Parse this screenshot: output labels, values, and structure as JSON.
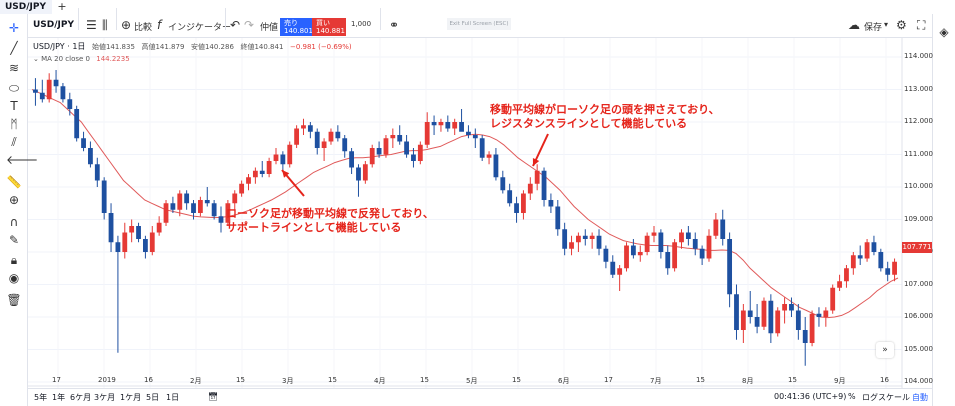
{
  "tabs": [
    {
      "label": "USD/JPY"
    }
  ],
  "toolbar": {
    "symbol": "USD/JPY",
    "compare_label": "比較",
    "indicators_label": "インジケーター",
    "order_label": "仲値",
    "sell_label": "売り",
    "sell_price": "140.801",
    "buy_label": "買い",
    "buy_price": "140.881",
    "quantity": "1,000",
    "exit_fullscreen": "Exit Full Screen (ESC)",
    "save_label": "保存"
  },
  "legend": {
    "symbol": "USD/JPY · 1日",
    "open": "始値141.835",
    "high": "高値141.879",
    "low": "安値140.286",
    "close": "終値140.841",
    "change": "−0.981 (−0.69%)",
    "ma_label": "MA 20 close 0",
    "ma_value": "144.2235"
  },
  "annotations": {
    "resistance_line1": "移動平均線がローソク足の頭を押さえており、",
    "resistance_line2": "レジスタンスラインとして機能している",
    "support_line1": "ローソク足が移動平均線で反発しており、",
    "support_line2": "サポートラインとして機能している"
  },
  "price_axis": {
    "labels": [
      "114.000",
      "113.000",
      "112.000",
      "111.000",
      "110.000",
      "109.000",
      "108.000",
      "107.000",
      "106.000",
      "105.000",
      "104.000"
    ],
    "last_price": "107.771"
  },
  "time_axis": {
    "labels": [
      "17",
      "2019",
      "16",
      "2月",
      "15",
      "3月",
      "15",
      "4月",
      "15",
      "5月",
      "15",
      "6月",
      "17",
      "7月",
      "15",
      "8月",
      "15",
      "9月",
      "16"
    ]
  },
  "bottom_bar": {
    "ranges": [
      "5年",
      "1年",
      "6ケ月",
      "3ケ月",
      "1ケ月",
      "5日",
      "1日"
    ],
    "time": "00:41:36 (UTC+9)",
    "percent": "%",
    "log": "ログスケール",
    "auto": "自動"
  },
  "chart_data": {
    "type": "candlestick",
    "series": "USD/JPY daily",
    "ylim": [
      104.0,
      114.4
    ],
    "colors": {
      "up": "#e53935",
      "down": "#1e50a0",
      "ma": "#e05a5a"
    },
    "candles": [
      [
        113.0,
        113.35,
        112.5,
        112.9
      ],
      [
        112.9,
        113.3,
        112.6,
        112.7
      ],
      [
        112.7,
        113.5,
        112.6,
        113.3
      ],
      [
        113.3,
        113.6,
        112.9,
        113.1
      ],
      [
        113.1,
        113.2,
        112.6,
        112.7
      ],
      [
        112.7,
        112.9,
        112.2,
        112.4
      ],
      [
        112.4,
        112.5,
        111.4,
        111.5
      ],
      [
        111.5,
        111.7,
        111.1,
        111.2
      ],
      [
        111.2,
        111.4,
        110.6,
        110.7
      ],
      [
        110.7,
        110.9,
        110.0,
        110.2
      ],
      [
        110.2,
        110.3,
        109.0,
        109.2
      ],
      [
        109.2,
        109.5,
        108.0,
        108.3
      ],
      [
        108.3,
        108.5,
        104.9,
        108.0
      ],
      [
        108.0,
        108.9,
        107.8,
        108.6
      ],
      [
        108.6,
        109.0,
        108.3,
        108.8
      ],
      [
        108.8,
        108.9,
        108.3,
        108.4
      ],
      [
        108.4,
        108.5,
        107.8,
        108.0
      ],
      [
        108.0,
        108.8,
        107.9,
        108.6
      ],
      [
        108.6,
        109.1,
        108.5,
        108.9
      ],
      [
        108.9,
        109.6,
        108.8,
        109.5
      ],
      [
        109.5,
        109.7,
        109.2,
        109.3
      ],
      [
        109.3,
        109.9,
        109.1,
        109.8
      ],
      [
        109.8,
        109.9,
        109.3,
        109.5
      ],
      [
        109.5,
        109.6,
        109.0,
        109.2
      ],
      [
        109.2,
        109.7,
        109.1,
        109.6
      ],
      [
        109.6,
        110.0,
        109.4,
        109.5
      ],
      [
        109.5,
        109.6,
        109.0,
        109.1
      ],
      [
        109.1,
        109.4,
        108.6,
        108.9
      ],
      [
        108.9,
        109.6,
        108.8,
        109.5
      ],
      [
        109.5,
        109.9,
        109.3,
        109.8
      ],
      [
        109.8,
        110.2,
        109.7,
        110.1
      ],
      [
        110.1,
        110.4,
        109.9,
        110.3
      ],
      [
        110.3,
        110.6,
        110.1,
        110.5
      ],
      [
        110.5,
        110.8,
        110.3,
        110.4
      ],
      [
        110.4,
        110.9,
        110.3,
        110.8
      ],
      [
        110.8,
        111.2,
        110.7,
        111.0
      ],
      [
        111.0,
        111.1,
        110.5,
        110.7
      ],
      [
        110.7,
        111.4,
        110.6,
        111.3
      ],
      [
        111.3,
        111.9,
        111.2,
        111.8
      ],
      [
        111.8,
        112.1,
        111.6,
        111.9
      ],
      [
        111.9,
        112.0,
        111.5,
        111.7
      ],
      [
        111.7,
        111.8,
        111.0,
        111.2
      ],
      [
        111.2,
        111.5,
        110.8,
        111.4
      ],
      [
        111.4,
        111.8,
        111.3,
        111.7
      ],
      [
        111.7,
        111.9,
        111.4,
        111.5
      ],
      [
        111.5,
        111.6,
        110.9,
        111.1
      ],
      [
        111.1,
        111.2,
        110.4,
        110.6
      ],
      [
        110.6,
        110.7,
        109.7,
        110.2
      ],
      [
        110.2,
        110.8,
        110.1,
        110.7
      ],
      [
        110.7,
        111.3,
        110.6,
        111.2
      ],
      [
        111.2,
        111.4,
        110.9,
        111.0
      ],
      [
        111.0,
        111.6,
        110.9,
        111.5
      ],
      [
        111.5,
        111.8,
        111.2,
        111.6
      ],
      [
        111.6,
        111.9,
        111.3,
        111.4
      ],
      [
        111.4,
        111.6,
        110.9,
        111.0
      ],
      [
        111.0,
        111.2,
        110.6,
        110.8
      ],
      [
        110.8,
        111.4,
        110.7,
        111.3
      ],
      [
        111.3,
        112.3,
        111.2,
        112.0
      ],
      [
        112.0,
        112.2,
        111.6,
        111.9
      ],
      [
        111.9,
        112.1,
        111.7,
        112.0
      ],
      [
        112.0,
        112.2,
        111.7,
        111.8
      ],
      [
        111.8,
        112.1,
        111.6,
        112.0
      ],
      [
        112.0,
        112.4,
        111.8,
        111.7
      ],
      [
        111.7,
        111.9,
        111.5,
        111.6
      ],
      [
        111.6,
        111.8,
        111.2,
        111.5
      ],
      [
        111.5,
        111.6,
        110.8,
        110.9
      ],
      [
        110.9,
        111.1,
        110.7,
        111.0
      ],
      [
        111.0,
        111.2,
        110.2,
        110.3
      ],
      [
        110.3,
        110.5,
        109.8,
        109.9
      ],
      [
        109.9,
        110.1,
        109.4,
        109.5
      ],
      [
        109.5,
        109.7,
        108.9,
        109.2
      ],
      [
        109.2,
        109.9,
        109.0,
        109.8
      ],
      [
        109.8,
        110.3,
        109.6,
        110.1
      ],
      [
        110.1,
        110.7,
        109.9,
        110.5
      ],
      [
        110.5,
        110.6,
        109.4,
        109.6
      ],
      [
        109.6,
        109.8,
        109.2,
        109.4
      ],
      [
        109.4,
        109.6,
        108.5,
        108.7
      ],
      [
        108.7,
        108.9,
        107.9,
        108.1
      ],
      [
        108.1,
        108.5,
        107.9,
        108.3
      ],
      [
        108.3,
        108.6,
        108.0,
        108.5
      ],
      [
        108.5,
        108.7,
        108.2,
        108.4
      ],
      [
        108.4,
        108.6,
        108.1,
        108.5
      ],
      [
        108.5,
        108.7,
        107.9,
        108.1
      ],
      [
        108.1,
        108.2,
        107.5,
        107.7
      ],
      [
        107.7,
        107.9,
        107.2,
        107.3
      ],
      [
        107.3,
        107.6,
        106.8,
        107.5
      ],
      [
        107.5,
        108.3,
        107.4,
        108.2
      ],
      [
        108.2,
        108.4,
        107.8,
        107.9
      ],
      [
        107.9,
        108.2,
        107.7,
        108.0
      ],
      [
        108.0,
        108.6,
        107.9,
        108.5
      ],
      [
        108.5,
        108.8,
        108.3,
        108.6
      ],
      [
        108.6,
        108.7,
        107.8,
        108.0
      ],
      [
        108.0,
        108.2,
        107.3,
        107.5
      ],
      [
        107.5,
        108.4,
        107.4,
        108.3
      ],
      [
        108.3,
        108.7,
        108.1,
        108.6
      ],
      [
        108.6,
        108.8,
        108.2,
        108.4
      ],
      [
        108.4,
        108.6,
        107.9,
        108.1
      ],
      [
        108.1,
        108.2,
        107.6,
        107.8
      ],
      [
        107.8,
        108.7,
        107.7,
        108.5
      ],
      [
        108.5,
        109.2,
        108.4,
        109.0
      ],
      [
        109.0,
        109.3,
        108.2,
        108.4
      ],
      [
        108.4,
        108.6,
        106.3,
        106.7
      ],
      [
        106.7,
        107.0,
        105.3,
        105.6
      ],
      [
        105.6,
        106.4,
        105.2,
        106.2
      ],
      [
        106.2,
        106.8,
        105.8,
        106.0
      ],
      [
        106.0,
        106.4,
        105.5,
        105.7
      ],
      [
        105.7,
        106.6,
        105.6,
        106.5
      ],
      [
        106.5,
        106.7,
        105.2,
        105.5
      ],
      [
        105.5,
        106.3,
        105.4,
        106.2
      ],
      [
        106.2,
        106.6,
        105.8,
        106.4
      ],
      [
        106.4,
        106.6,
        106.0,
        106.2
      ],
      [
        106.2,
        106.4,
        105.3,
        105.6
      ],
      [
        105.6,
        106.0,
        104.5,
        105.2
      ],
      [
        105.2,
        106.2,
        105.1,
        106.1
      ],
      [
        106.1,
        106.3,
        105.7,
        106.0
      ],
      [
        106.0,
        106.3,
        105.7,
        106.2
      ],
      [
        106.2,
        107.0,
        106.1,
        106.9
      ],
      [
        106.9,
        107.3,
        106.8,
        107.1
      ],
      [
        107.1,
        107.6,
        106.9,
        107.5
      ],
      [
        107.5,
        108.0,
        107.3,
        107.9
      ],
      [
        107.9,
        108.2,
        107.6,
        107.8
      ],
      [
        107.8,
        108.4,
        107.7,
        108.3
      ],
      [
        108.3,
        108.5,
        107.9,
        108.0
      ],
      [
        108.0,
        108.1,
        107.4,
        107.5
      ],
      [
        107.5,
        107.7,
        107.1,
        107.3
      ],
      [
        107.3,
        107.8,
        107.1,
        107.7
      ]
    ],
    "ma_points": [
      113.0,
      112.9,
      112.8,
      112.7,
      112.6,
      112.4,
      112.2,
      112.0,
      111.7,
      111.4,
      111.1,
      110.8,
      110.5,
      110.2,
      110.0,
      109.8,
      109.6,
      109.5,
      109.4,
      109.3,
      109.25,
      109.2,
      109.15,
      109.1,
      109.08,
      109.07,
      109.06,
      109.07,
      109.1,
      109.15,
      109.22,
      109.3,
      109.4,
      109.5,
      109.6,
      109.72,
      109.85,
      110.0,
      110.15,
      110.3,
      110.45,
      110.55,
      110.65,
      110.75,
      110.82,
      110.88,
      110.9,
      110.9,
      110.92,
      110.95,
      110.98,
      111.0,
      111.05,
      111.1,
      111.12,
      111.12,
      111.15,
      111.2,
      111.25,
      111.35,
      111.45,
      111.55,
      111.6,
      111.62,
      111.6,
      111.55,
      111.45,
      111.3,
      111.1,
      110.9,
      110.75,
      110.6,
      110.45,
      110.3,
      110.1,
      109.9,
      109.65,
      109.4,
      109.2,
      109.0,
      108.85,
      108.7,
      108.55,
      108.45,
      108.35,
      108.3,
      108.25,
      108.22,
      108.2,
      108.2,
      108.2,
      108.18,
      108.15,
      108.12,
      108.1,
      108.08,
      108.05,
      108.05,
      108.06,
      108.05,
      107.95,
      107.75,
      107.5,
      107.3,
      107.1,
      106.9,
      106.75,
      106.6,
      106.45,
      106.3,
      106.2,
      106.1,
      106.0,
      105.98,
      106.0,
      106.05,
      106.15,
      106.3,
      106.45,
      106.6,
      106.8,
      106.95,
      107.1,
      107.2
    ]
  }
}
